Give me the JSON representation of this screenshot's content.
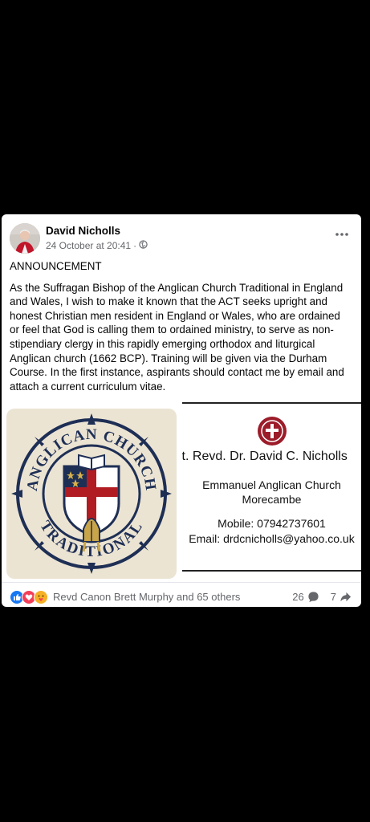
{
  "post": {
    "author": "David Nicholls",
    "timestamp": "24 October at 20:41",
    "separator": "·",
    "privacy_icon": "globe-icon",
    "heading": "ANNOUNCEMENT",
    "body": "As the Suffragan Bishop of the Anglican Church Traditional in England and Wales, I wish to make it known that the ACT seeks upright and honest Christian men resident in England or Wales, who are ordained or feel that God is calling them to ordained ministry, to serve as non-stipendiary clergy in this rapidly emerging orthodox and liturgical Anglican church (1662 BCP).  Training will be given via the Durham Course. In the first instance, aspirants should contact me by email and attach a current curriculum vitae.",
    "more_icon": "more-horizontal-icon"
  },
  "logo": {
    "text_top": "ANGLICAN CHURCH",
    "text_bottom": "TRADITIONAL"
  },
  "card": {
    "name": "Rt. Revd. Dr. David C. Nicholls",
    "church": "Emmanuel Anglican Church",
    "town": "Morecambe",
    "mobile": "Mobile: 07942737601",
    "email": "Email: drdcnicholls@yahoo.co.uk"
  },
  "footer": {
    "reactions_text": "Revd Canon Brett Murphy and 65 others",
    "comments_count": "26",
    "shares_count": "7",
    "reaction_icons": [
      "like-icon",
      "love-icon",
      "care-icon"
    ]
  },
  "colors": {
    "background": "#000000",
    "card": "#ffffff",
    "like_blue": "#1877f2",
    "love_red": "#f33e58",
    "logo_navy": "#1e2f55",
    "logo_red": "#b01c22"
  }
}
